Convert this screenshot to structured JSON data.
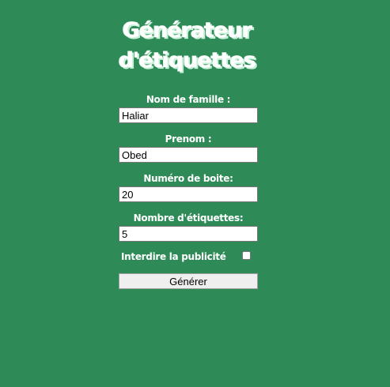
{
  "page": {
    "title_line1": "Générateur",
    "title_line2": "d'étiquettes"
  },
  "form": {
    "last_name": {
      "label": "Nom de famille :",
      "value": "Haliar"
    },
    "first_name": {
      "label": "Prenom :",
      "value": "Obed"
    },
    "box_number": {
      "label": "Numéro de boite:",
      "value": "20"
    },
    "label_count": {
      "label": "Nombre d'étiquettes:",
      "value": "5"
    },
    "no_ads": {
      "label": "Interdire la publicité",
      "checked": false
    },
    "submit_label": "Générer"
  },
  "colors": {
    "background": "#2e8b57",
    "text": "#ffffff"
  }
}
